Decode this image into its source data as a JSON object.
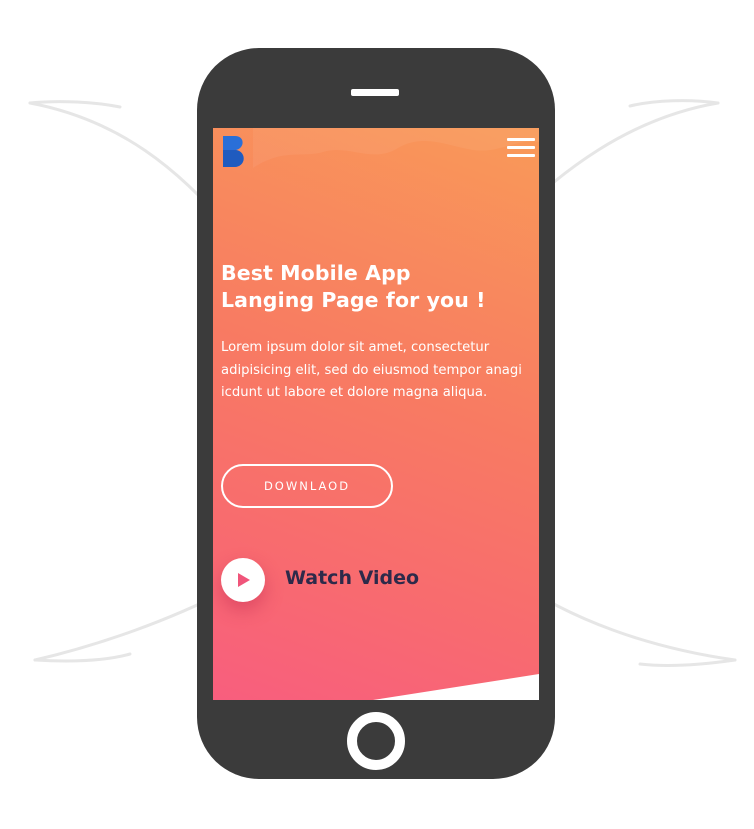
{
  "hero": {
    "headline_line1": "Best Mobile App",
    "headline_line2": "Langing Page for you !",
    "description": "Lorem ipsum dolor sit amet, consectetur adipisicing elit, sed do eiusmod tempor anagi icdunt ut labore et dolore magna aliqua.",
    "download_label": "DOWNLAOD",
    "watch_video_label": "Watch Video"
  },
  "icons": {
    "logo": "logo-b-icon",
    "menu": "hamburger-menu-icon",
    "play": "play-icon"
  },
  "colors": {
    "phone_body": "#3b3b3b",
    "gradient_top": "#f99a58",
    "gradient_bottom": "#f85e7e",
    "play_triangle": "#f0557a",
    "watch_video_text": "#2d2a4a",
    "logo_blue": "#2a6fd8"
  }
}
